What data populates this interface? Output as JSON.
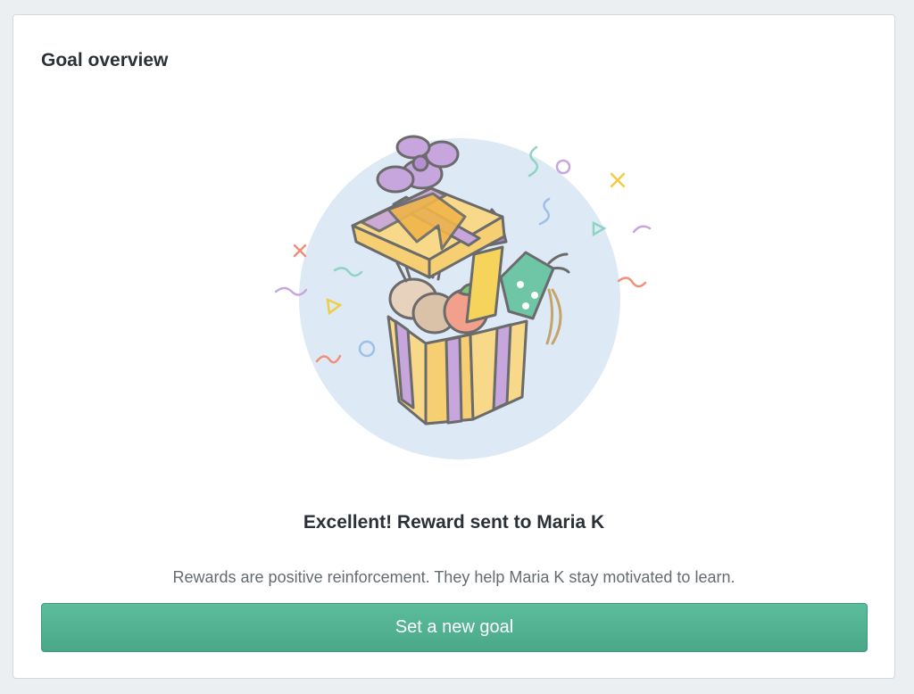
{
  "card": {
    "title": "Goal overview",
    "headline": "Excellent! Reward sent to Maria K",
    "subtext": "Rewards are positive reinforcement. They help Maria K stay motivated to learn.",
    "button_label": "Set a new goal"
  },
  "colors": {
    "button": "#4fb291",
    "circle": "#dde9f5",
    "gift_yellow": "#f7d989",
    "ribbon_purple": "#c7a6dd",
    "outline": "#6b6b6b"
  },
  "icons": [
    "gift-box-illustration",
    "confetti"
  ]
}
